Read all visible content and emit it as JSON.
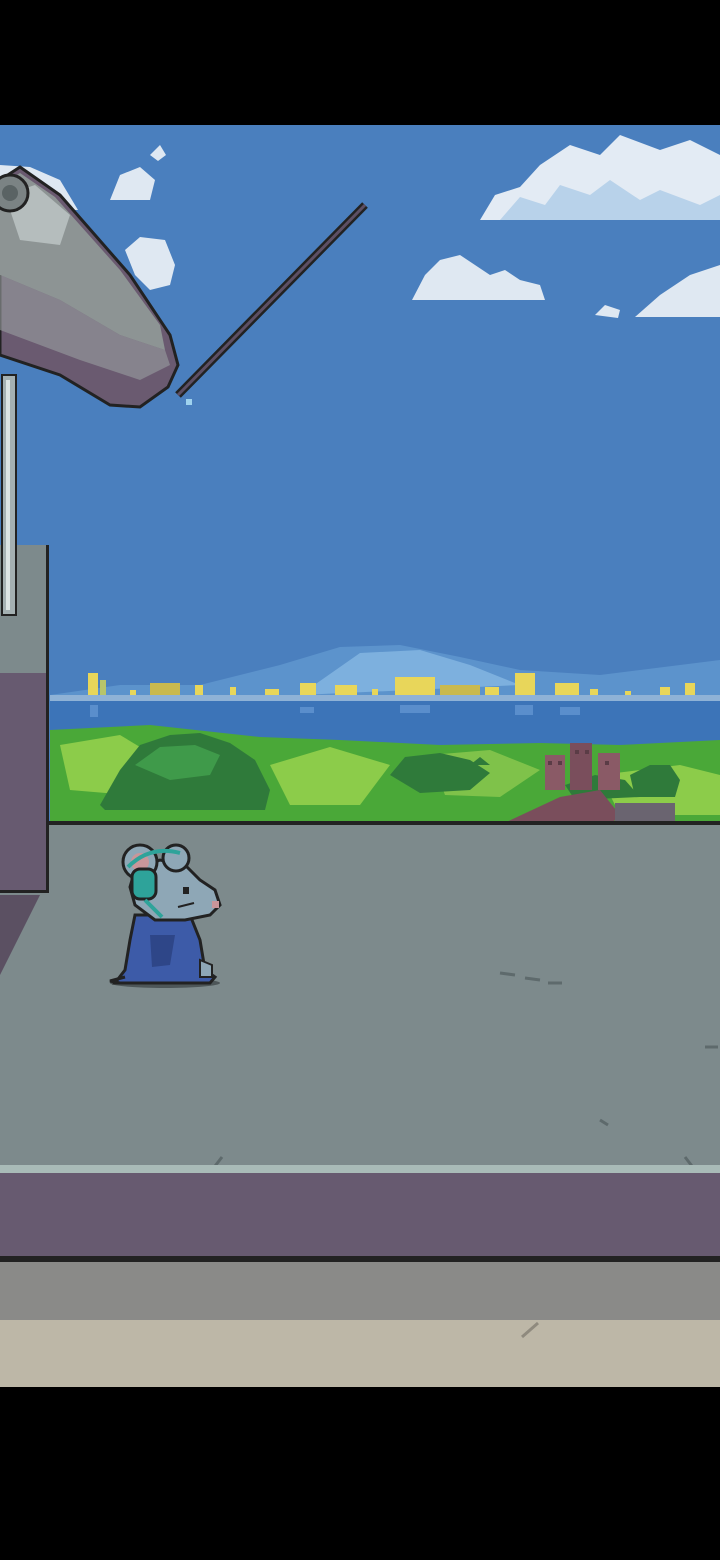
{
  "game": {
    "scene": "rooftop-observatory",
    "palette": {
      "sky": "#4a7fbe",
      "sky_light": "#6ea6d8",
      "cloud": "#dfe8f2",
      "mountain": "#5a8fc8",
      "sea": "#3c74b8",
      "city_light": "#e8d65a",
      "grass": "#4aa838",
      "grass_light": "#8ccc4a",
      "bush": "#2f7a3a",
      "rooftop": "#7d8a8c",
      "ledge": "#675a70",
      "street": "#8a8a88",
      "sidewalk": "#bdb7a7",
      "telescope": "#8d9494",
      "mouse_body": "#8ea7b6",
      "mouse_robe": "#3d5ba8",
      "headphones": "#2ea39a"
    },
    "characters": [
      {
        "name": "mouse",
        "facing": "right",
        "accessory": "headphones"
      }
    ],
    "props": [
      "telescope",
      "stand",
      "railing-post"
    ]
  }
}
